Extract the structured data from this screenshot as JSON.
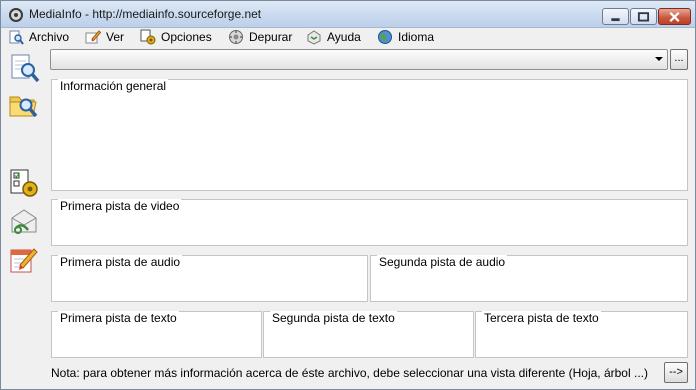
{
  "window": {
    "title": "MediaInfo - http://mediainfo.sourceforge.net"
  },
  "menu": [
    {
      "label": "Archivo",
      "icon": "archive-magnifier-icon"
    },
    {
      "label": "Ver",
      "icon": "view-pencil-icon"
    },
    {
      "label": "Opciones",
      "icon": "options-gear-icon"
    },
    {
      "label": "Depurar",
      "icon": "debug-icon"
    },
    {
      "label": "Ayuda",
      "icon": "help-icon"
    },
    {
      "label": "Idioma",
      "icon": "globe-icon"
    }
  ],
  "toolbar": [
    {
      "icon": "open-file-icon"
    },
    {
      "icon": "open-folder-icon"
    },
    {
      "icon": "preferences-icon"
    },
    {
      "icon": "email-icon"
    },
    {
      "icon": "notepad-icon"
    }
  ],
  "file_combo": {
    "value": "",
    "browse_label": "..."
  },
  "sections": {
    "general": "Información general",
    "video1": "Primera pista de video",
    "audio1": "Primera pista de audio",
    "audio2": "Segunda pista de audio",
    "text1": "Primera pista de texto",
    "text2": "Segunda pista de texto",
    "text3": "Tercera pista de texto"
  },
  "status": {
    "note": "Nota: para obtener más información acerca de éste archivo, debe seleccionar una vista diferente (Hoja, árbol ...)",
    "more_label": "-->"
  }
}
